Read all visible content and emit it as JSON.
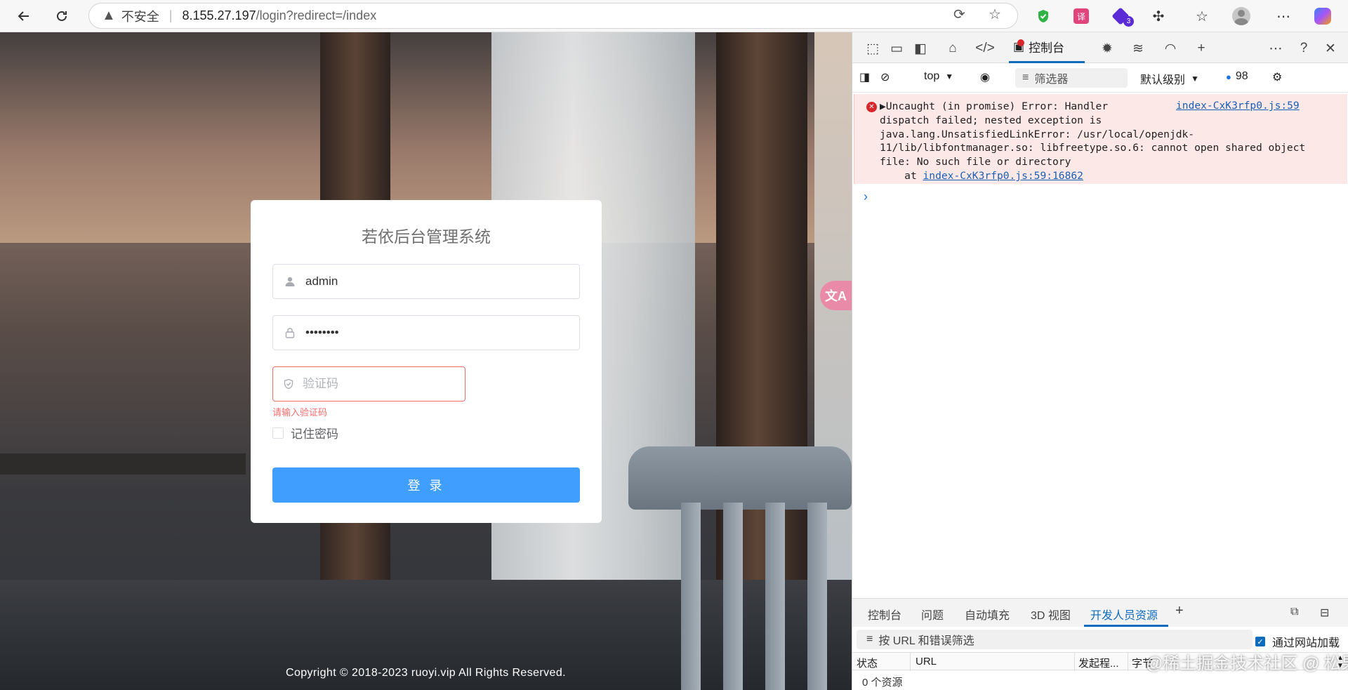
{
  "browser": {
    "insecure_label": "不安全",
    "url_host": "8.155.27.197",
    "url_path": "/login?redirect=/index",
    "extension_badge": "3"
  },
  "login": {
    "title": "若依后台管理系统",
    "username_value": "admin",
    "password_value": "••••••••",
    "captcha_placeholder": "验证码",
    "captcha_error": "请输入验证码",
    "remember_label": "记住密码",
    "login_button": "登 录",
    "copyright": "Copyright © 2018-2023 ruoyi.vip All Rights Reserved."
  },
  "devtools": {
    "console_tab": "控制台",
    "context_select": "top",
    "filter_label": "筛选器",
    "level_select": "默认级别",
    "message_count": "98",
    "error": {
      "message": "Uncaught (in promise) Error: Handler\ndispatch failed; nested exception is\njava.lang.UnsatisfiedLinkError: /usr/local/openjdk-\n11/lib/libfontmanager.so: libfreetype.so.6: cannot open shared object\nfile: No such file or directory\n    at ",
      "source": "index-CxK3rfp0.js:59",
      "at_link": "index-CxK3rfp0.js:59:16862"
    },
    "drawer": {
      "tabs": [
        "控制台",
        "问题",
        "自动填充",
        "3D 视图",
        "开发人员资源"
      ],
      "active_tab": "开发人员资源",
      "filter_placeholder": "按 URL 和错误筛选",
      "checkbox_label": "通过网站加载",
      "columns": [
        "状态",
        "URL",
        "发起程...",
        "字节"
      ],
      "resource_count": "0 个资源",
      "watermark": "@稀土掘金技术社区 @ 松果猿"
    }
  },
  "colors": {
    "primary": "#409eff",
    "error": "#f56c6c",
    "devtools_accent": "#0f6cbd"
  }
}
